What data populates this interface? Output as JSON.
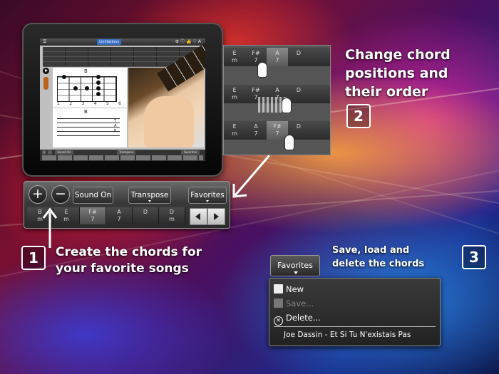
{
  "ipad": {
    "screen_title": "Limitations",
    "toolbar_sound": "Sound On",
    "toolbar_transpose": "Transpose",
    "toolbar_favorites": "Favorites",
    "chord_name": "B",
    "fret_numbers": [
      "1",
      "2",
      "3",
      "4",
      "5",
      "6"
    ],
    "tab_letters": [
      "T",
      "A",
      "B"
    ]
  },
  "toolbar": {
    "add_label": "+",
    "remove_label": "−",
    "sound_label": "Sound On",
    "transpose_label": "Transpose",
    "favorites_label": "Favorites",
    "chords": [
      {
        "root": "B",
        "quality": "m"
      },
      {
        "root": "E",
        "quality": "m"
      },
      {
        "root": "F#",
        "quality": "7"
      },
      {
        "root": "A",
        "quality": "7"
      },
      {
        "root": "D",
        "quality": ""
      },
      {
        "root": "D",
        "quality": "m"
      }
    ]
  },
  "reorder_panel": {
    "row1": [
      {
        "root": "E",
        "quality": "m"
      },
      {
        "root": "F#",
        "quality": "7"
      },
      {
        "root": "A",
        "quality": "7"
      },
      {
        "root": "D",
        "quality": ""
      }
    ],
    "row2": [
      {
        "root": "E",
        "quality": "m"
      },
      {
        "root": "F#",
        "quality": "7"
      },
      {
        "root": "A",
        "quality": "7"
      },
      {
        "root": "D",
        "quality": ""
      }
    ],
    "row3": [
      {
        "root": "E",
        "quality": "m"
      },
      {
        "root": "A",
        "quality": "7"
      },
      {
        "root": "F#",
        "quality": "7"
      },
      {
        "root": "D",
        "quality": ""
      }
    ]
  },
  "captions": {
    "step1_number": "1",
    "step1_line1": "Create the chords for",
    "step1_line2": "your favorite songs",
    "step2_number": "2",
    "step2_line1": "Change chord",
    "step2_line2": "positions and",
    "step2_line3": "their order",
    "step3_number": "3",
    "step3_line1": "Save, load and",
    "step3_line2": "delete the chords"
  },
  "favorites_menu": {
    "button_label": "Favorites",
    "new_label": "New",
    "save_label": "Save...",
    "delete_label": "Delete...",
    "song_label": "Joe Dassin - Et Si Tu N'existais Pas"
  },
  "colors": {
    "accent_blue": "#3a6fc4",
    "toolbar_dark": "#2a2a2a",
    "caption_text": "#ffffff"
  }
}
